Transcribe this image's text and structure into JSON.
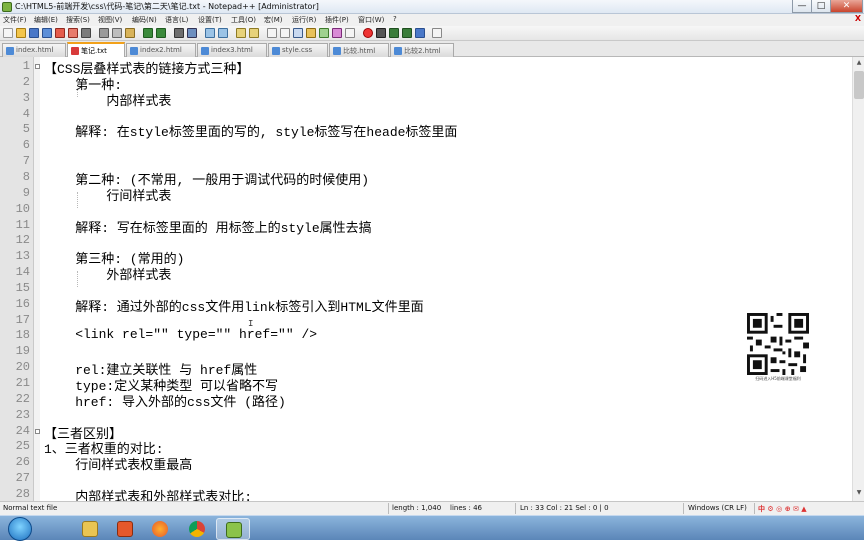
{
  "window": {
    "title": "C:\\HTML5-前端开发\\css\\代码-笔记\\第二天\\笔记.txt - Notepad++ [Administrator]",
    "min_label": "—",
    "max_label": "□",
    "close_label": "✕"
  },
  "menu": {
    "items": [
      "文件(F)",
      "编辑(E)",
      "搜索(S)",
      "视图(V)",
      "编码(N)",
      "语言(L)",
      "设置(T)",
      "工具(O)",
      "宏(M)",
      "运行(R)",
      "插件(P)",
      "窗口(W)",
      "?"
    ],
    "close": "X"
  },
  "tabs": [
    {
      "label": "index.html",
      "active": false
    },
    {
      "label": "笔记.txt",
      "active": true
    },
    {
      "label": "index2.html",
      "active": false
    },
    {
      "label": "index3.html",
      "active": false
    },
    {
      "label": "style.css",
      "active": false
    },
    {
      "label": "比较.html",
      "active": false
    },
    {
      "label": "比较2.html",
      "active": false
    }
  ],
  "editor": {
    "lines": [
      {
        "n": "1",
        "text": "【CSS层叠样式表的链接方式三种】"
      },
      {
        "n": "2",
        "text": "    第一种:"
      },
      {
        "n": "3",
        "text": "        内部样式表"
      },
      {
        "n": "4",
        "text": ""
      },
      {
        "n": "5",
        "text": "    解释: 在style标签里面的写的, style标签写在heade标签里面"
      },
      {
        "n": "6",
        "text": ""
      },
      {
        "n": "7",
        "text": ""
      },
      {
        "n": "8",
        "text": "    第二种: (不常用, 一般用于调试代码的时候使用)"
      },
      {
        "n": "9",
        "text": "        行间样式表"
      },
      {
        "n": "10",
        "text": ""
      },
      {
        "n": "11",
        "text": "    解释: 写在标签里面的 用标签上的style属性去搞"
      },
      {
        "n": "12",
        "text": ""
      },
      {
        "n": "13",
        "text": "    第三种: (常用的)"
      },
      {
        "n": "14",
        "text": "        外部样式表"
      },
      {
        "n": "15",
        "text": ""
      },
      {
        "n": "16",
        "text": "    解释: 通过外部的css文件用link标签引入到HTML文件里面"
      },
      {
        "n": "17",
        "text": ""
      },
      {
        "n": "18",
        "text": "    <link rel=\"\" type=\"\" href=\"\" />"
      },
      {
        "n": "19",
        "text": ""
      },
      {
        "n": "20",
        "text": "    rel:建立关联性 与 href属性"
      },
      {
        "n": "21",
        "text": "    type:定义某种类型 可以省略不写"
      },
      {
        "n": "22",
        "text": "    href: 导入外部的css文件 (路径)"
      },
      {
        "n": "23",
        "text": ""
      },
      {
        "n": "24",
        "text": "【三者区别】"
      },
      {
        "n": "25",
        "text": "1、三者权重的对比:"
      },
      {
        "n": "26",
        "text": "    行间样式表权重最高"
      },
      {
        "n": "27",
        "text": ""
      },
      {
        "n": "28",
        "text": "    内部样式表和外部样式表对比:"
      }
    ]
  },
  "qr_caption": "扫码进入H5前端课堂福利",
  "status": {
    "filetype": "Normal text file",
    "length": "length : 1,040",
    "lines": "lines : 46",
    "position": "Ln : 33    Col : 21    Sel : 0 | 0",
    "eol": "Windows (CR LF)"
  },
  "tray": {
    "text": "中 ⚙ ◎ ⊕ ✉ ▲"
  }
}
